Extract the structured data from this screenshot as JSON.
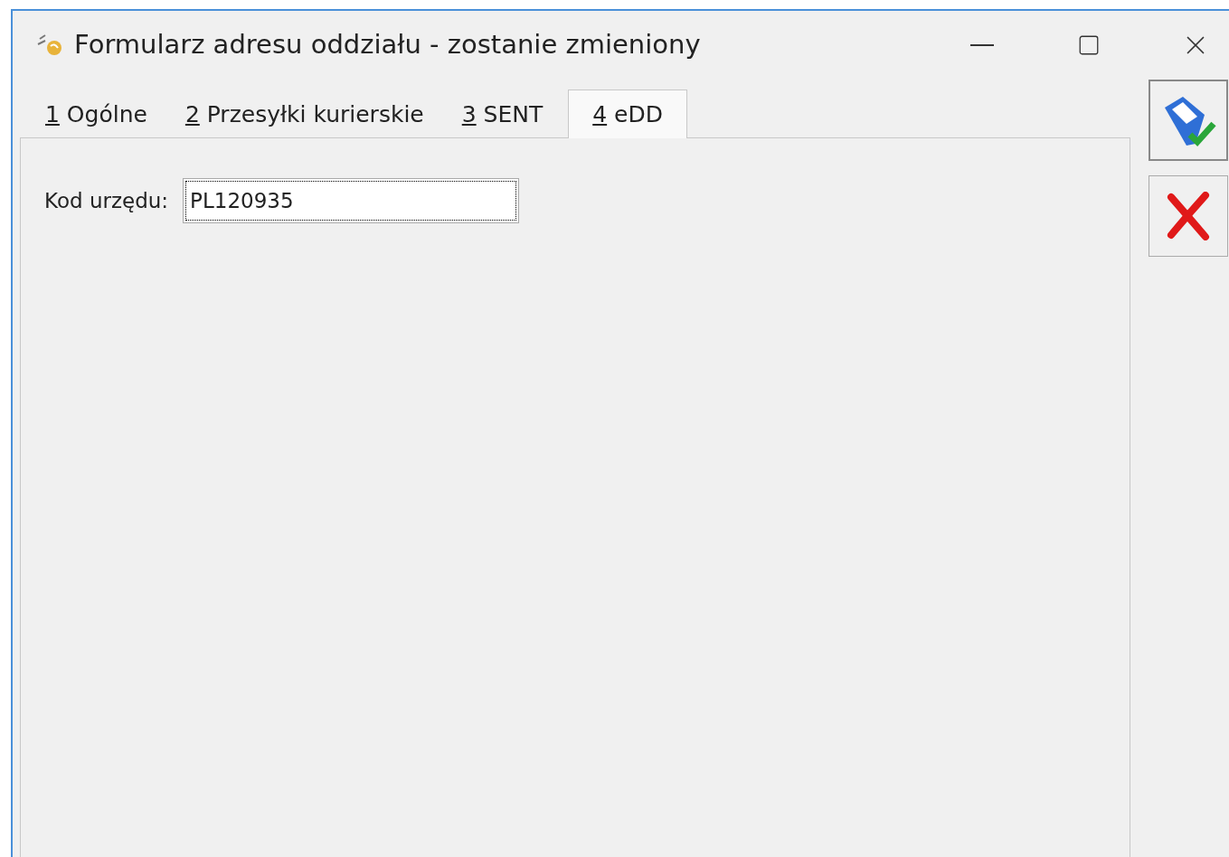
{
  "window": {
    "title": "Formularz adresu oddziału - zostanie zmieniony"
  },
  "tabs": [
    {
      "key": "1",
      "label": "Ogólne",
      "selected": false
    },
    {
      "key": "2",
      "label": "Przesyłki kurierskie",
      "selected": false
    },
    {
      "key": "3",
      "label": "SENT",
      "selected": false
    },
    {
      "key": "4",
      "label": "eDD",
      "selected": true
    }
  ],
  "form": {
    "label": "Kod urzędu:",
    "value": "PL120935",
    "focused": true
  }
}
